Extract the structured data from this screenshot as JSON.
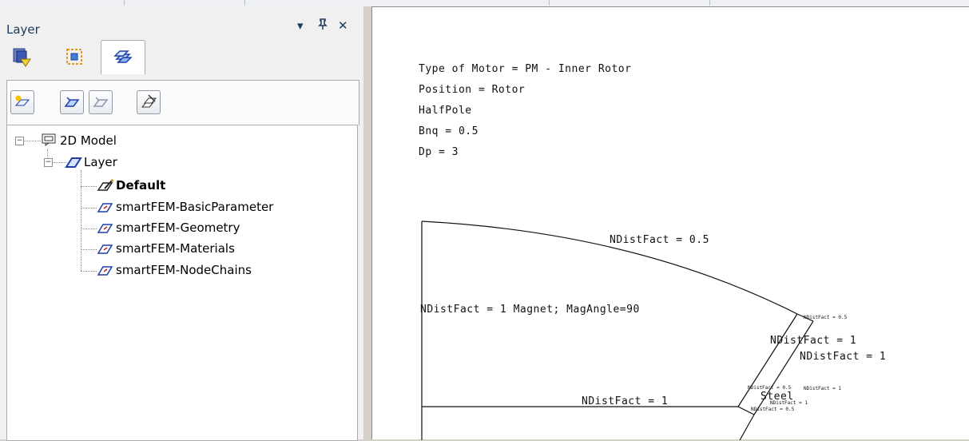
{
  "panel": {
    "title": "Layer",
    "controls": {
      "dropdown": "▾",
      "pin": "ᵖ",
      "close": "✕"
    }
  },
  "tree": {
    "root": {
      "label": "2D Model",
      "expander": "−"
    },
    "layer": {
      "label": "Layer",
      "expander": "−"
    },
    "items": [
      {
        "label": "Default",
        "active": true
      },
      {
        "label": "smartFEM-BasicParameter"
      },
      {
        "label": "smartFEM-Geometry"
      },
      {
        "label": "smartFEM-Materials"
      },
      {
        "label": "smartFEM-NodeChains"
      }
    ]
  },
  "canvas": {
    "info_lines": [
      "Type of Motor = PM - Inner Rotor",
      "Position = Rotor",
      "HalfPole",
      "Bnq = 0.5",
      "Dp = 3"
    ],
    "labels": {
      "arc": "NDistFact = 0.5",
      "magnet": "NDistFact = 1 Magnet; MagAngle=90",
      "small_top": "NDistFact = 0.5",
      "mid1": "NDistFact = 1",
      "mid2": "NDistFact = 1",
      "bottom": "NDistFact = 1",
      "steel": "Steel",
      "tiny1": "NDistFact = 0.5",
      "tiny2": "NDistFact = 1",
      "tiny3": "NDistFact = 0.5",
      "tiny4": "NDistFact = 1"
    }
  },
  "colors": {
    "accent": "#1e395b",
    "layer_icon": "#1f3fa6",
    "layer_icon_red": "#c81e1e"
  }
}
